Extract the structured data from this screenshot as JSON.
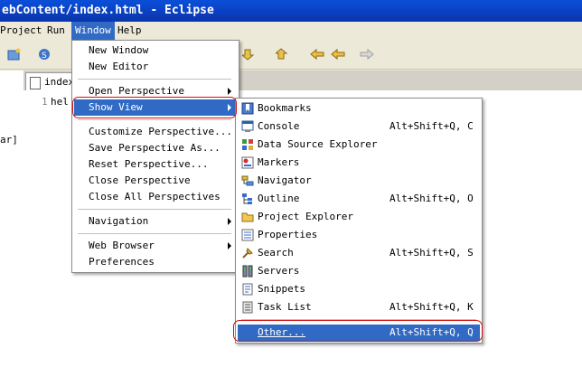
{
  "window": {
    "title": "ebContent/index.html - Eclipse"
  },
  "menubar": {
    "items": [
      {
        "label": "Project"
      },
      {
        "label": "Run"
      },
      {
        "label": "Window"
      },
      {
        "label": "Help"
      }
    ]
  },
  "editor": {
    "tab_label": "index",
    "line_number": "1",
    "line_text": "hel",
    "left_fragment": "ar]"
  },
  "window_menu": {
    "items": [
      {
        "label": "New Window"
      },
      {
        "label": "New Editor"
      },
      {
        "label": "Open Perspective"
      },
      {
        "label": "Show View"
      },
      {
        "label": "Customize Perspective..."
      },
      {
        "label": "Save Perspective As..."
      },
      {
        "label": "Reset Perspective..."
      },
      {
        "label": "Close Perspective"
      },
      {
        "label": "Close All Perspectives"
      },
      {
        "label": "Navigation"
      },
      {
        "label": "Web Browser"
      },
      {
        "label": "Preferences"
      }
    ]
  },
  "show_view_menu": {
    "items": [
      {
        "label": "Bookmarks",
        "shortcut": "",
        "icon": "bookmarks-icon"
      },
      {
        "label": "Console",
        "shortcut": "Alt+Shift+Q, C",
        "icon": "console-icon"
      },
      {
        "label": "Data Source Explorer",
        "shortcut": "",
        "icon": "data-source-icon"
      },
      {
        "label": "Markers",
        "shortcut": "",
        "icon": "markers-icon"
      },
      {
        "label": "Navigator",
        "shortcut": "",
        "icon": "navigator-icon"
      },
      {
        "label": "Outline",
        "shortcut": "Alt+Shift+Q, O",
        "icon": "outline-icon"
      },
      {
        "label": "Project Explorer",
        "shortcut": "",
        "icon": "folder-icon"
      },
      {
        "label": "Properties",
        "shortcut": "",
        "icon": "properties-icon"
      },
      {
        "label": "Search",
        "shortcut": "Alt+Shift+Q, S",
        "icon": "search-icon"
      },
      {
        "label": "Servers",
        "shortcut": "",
        "icon": "servers-icon"
      },
      {
        "label": "Snippets",
        "shortcut": "",
        "icon": "snippets-icon"
      },
      {
        "label": "Task List",
        "shortcut": "Alt+Shift+Q, K",
        "icon": "task-list-icon"
      },
      {
        "label": "Other...",
        "shortcut": "Alt+Shift+Q, Q",
        "icon": ""
      }
    ]
  },
  "colors": {
    "selection": "#316ac5",
    "titlebar": "#0a3fc0",
    "highlight_box": "#d01010"
  }
}
